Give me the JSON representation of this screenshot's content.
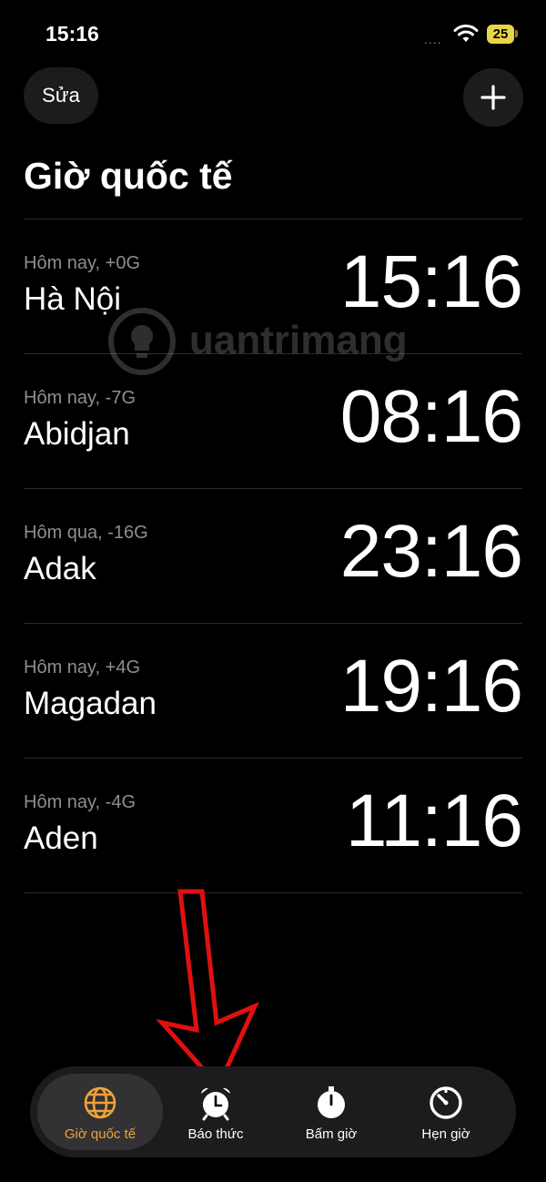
{
  "status_bar": {
    "time": "15:16",
    "battery": "25",
    "signal": "....",
    "wifi_icon": "wifi-icon"
  },
  "header": {
    "edit_label": "Sửa",
    "add_icon": "plus-icon",
    "title": "Giờ quốc tế"
  },
  "clocks": [
    {
      "subtitle": "Hôm nay, +0G",
      "city": "Hà Nội",
      "time": "15:16"
    },
    {
      "subtitle": "Hôm nay, -7G",
      "city": "Abidjan",
      "time": "08:16"
    },
    {
      "subtitle": "Hôm qua, -16G",
      "city": "Adak",
      "time": "23:16"
    },
    {
      "subtitle": "Hôm nay, +4G",
      "city": "Magadan",
      "time": "19:16"
    },
    {
      "subtitle": "Hôm nay, -4G",
      "city": "Aden",
      "time": "11:16"
    }
  ],
  "watermark": {
    "text": "uantrimang"
  },
  "tabs": [
    {
      "label": "Giờ quốc tế",
      "icon": "globe-icon",
      "active": true
    },
    {
      "label": "Báo thức",
      "icon": "alarm-clock-icon",
      "active": false
    },
    {
      "label": "Bấm giờ",
      "icon": "stopwatch-icon",
      "active": false
    },
    {
      "label": "Hẹn giờ",
      "icon": "timer-icon",
      "active": false
    }
  ],
  "colors": {
    "accent": "#f2a235",
    "background": "#000000",
    "secondary_text": "#8e8e93",
    "annotation_arrow": "#e01010"
  }
}
